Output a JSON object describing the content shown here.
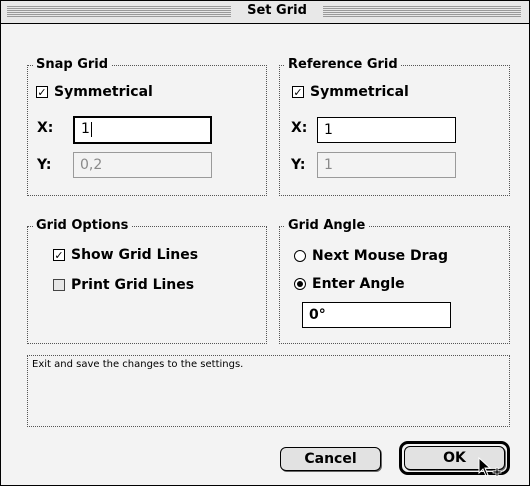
{
  "window": {
    "title": "Set Grid"
  },
  "snap_grid": {
    "label": "Snap Grid",
    "symmetrical": {
      "label": "Symmetrical",
      "checked": true
    },
    "x": {
      "label": "X:",
      "value": "1"
    },
    "y": {
      "label": "Y:",
      "value": "0,2",
      "disabled": true
    }
  },
  "reference_grid": {
    "label": "Reference Grid",
    "symmetrical": {
      "label": "Symmetrical",
      "checked": true
    },
    "x": {
      "label": "X:",
      "value": "1"
    },
    "y": {
      "label": "Y:",
      "value": "1",
      "disabled": true
    }
  },
  "grid_options": {
    "label": "Grid Options",
    "show_grid_lines": {
      "label": "Show Grid Lines",
      "checked": true
    },
    "print_grid_lines": {
      "label": "Print Grid Lines",
      "checked": false
    }
  },
  "grid_angle": {
    "label": "Grid Angle",
    "next_mouse_drag": {
      "label": "Next Mouse Drag",
      "selected": false
    },
    "enter_angle": {
      "label": "Enter Angle",
      "selected": true
    },
    "angle_value": "0°"
  },
  "help_text": "Exit and save the changes to the settings.",
  "buttons": {
    "cancel": "Cancel",
    "ok": "OK"
  }
}
